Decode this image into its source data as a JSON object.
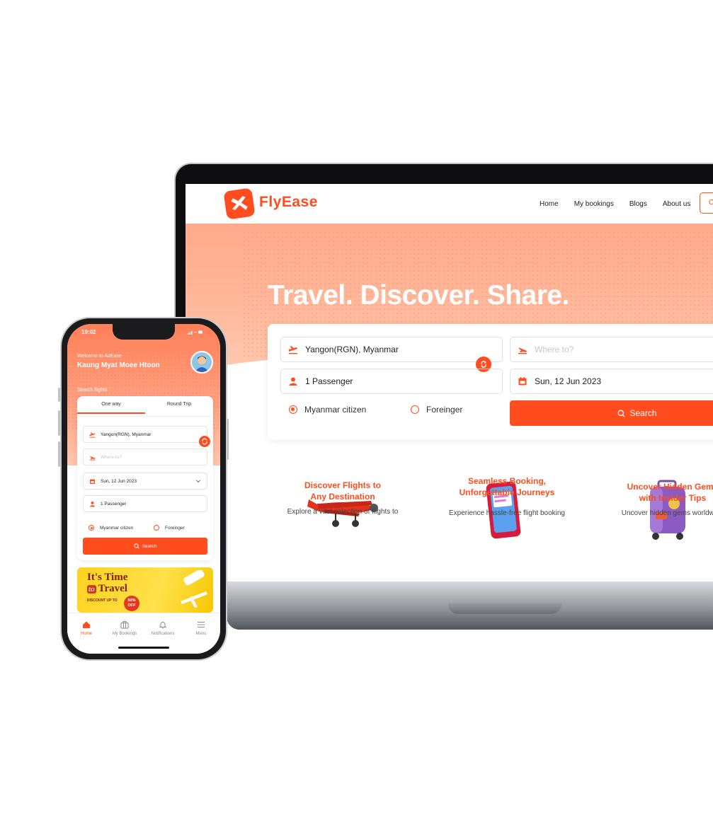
{
  "web": {
    "brand": "FlyEase",
    "nav": [
      "Home",
      "My bookings",
      "Blogs",
      "About us"
    ],
    "login_label": "C",
    "hero_title": "Travel. Discover. Share.",
    "from_value": "Yangon(RGN), Myanmar",
    "to_placeholder": "Where to?",
    "passenger_value": "1 Passenger",
    "date_value": "Sun, 12 Jun 2023",
    "citizen_options": [
      "Myanmar citizen",
      "Foreinger"
    ],
    "selected_citizen": "Myanmar citizen",
    "search_label": "Search",
    "features": [
      {
        "title_line1": "Discover Flights to",
        "title_line2": "Any Destination",
        "text": "Explore a vast selection of flights to"
      },
      {
        "title_line1": "Seamless Booking,",
        "title_line2": "Unforgettable Journeys",
        "text": "Experience hassle-free flight booking"
      },
      {
        "title_line1": "Uncover Hidden Gems",
        "title_line2": "with Insider Tips",
        "text": "Uncover hidden gems worldwide"
      }
    ]
  },
  "mobile": {
    "time": "19:02",
    "welcome": "Welcome to AirEase",
    "user_name": "Kaung Myat Moee Htoon",
    "section_label": "Search flights",
    "tabs": [
      "One way",
      "Round Trip"
    ],
    "active_tab": "One way",
    "from_value": "Yangon(RGN), Myanmar",
    "to_placeholder": "Where to?",
    "date_value": "Sun, 12 Jun 2023",
    "passenger_value": "1 Passenger",
    "citizen_options": [
      "Myanmar citizen",
      "Foreinger"
    ],
    "search_label": "Search",
    "banner": {
      "line1": "It's Time",
      "line2_prefix": "to",
      "line2": "Travel",
      "discount": "DISCOUNT UP TO",
      "badge": "50% OFF"
    },
    "bottom_nav": [
      "Home",
      "My Bookings",
      "Notifications",
      "Menu"
    ],
    "active_nav": "Home"
  },
  "colors": {
    "accent": "#ff4d1f",
    "hero": "#ffa98b",
    "banner": "#ffd21f"
  }
}
